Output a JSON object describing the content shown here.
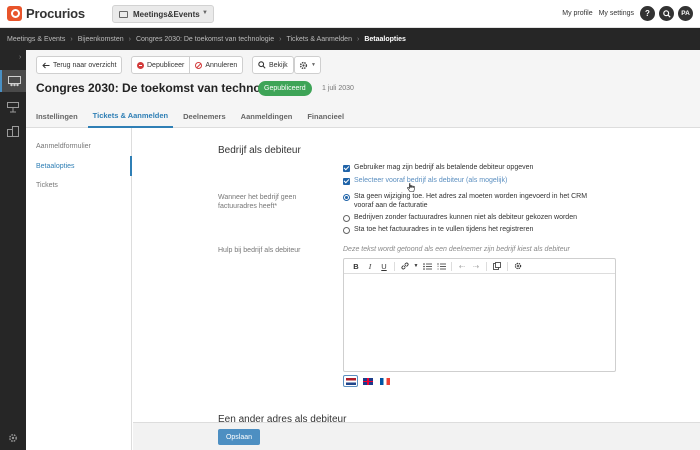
{
  "topbar": {
    "logo_text": "Procurios",
    "module": "Meetings&Events",
    "profile_link": "My profile",
    "settings_link": "My settings",
    "help_label": "?",
    "avatar_initials": "PA"
  },
  "breadcrumb": [
    "Meetings & Events",
    "Bijeenkomsten",
    "Congres 2030: De toekomst van technologie",
    "Tickets & Aanmelden",
    "Betaalopties"
  ],
  "toolbar": {
    "back_label": "Terug naar overzicht",
    "depublish_label": "Depubliceer",
    "cancel_label": "Annuleren",
    "view_label": "Bekijk"
  },
  "page": {
    "title": "Congres 2030: De toekomst van technologie",
    "status": "Gepubliceerd",
    "date": "1 juli 2030"
  },
  "tabs": [
    {
      "label": "Instellingen",
      "active": false
    },
    {
      "label": "Tickets & Aanmelden",
      "active": true
    },
    {
      "label": "Deelnemers",
      "active": false
    },
    {
      "label": "Aanmeldingen",
      "active": false
    },
    {
      "label": "Financieel",
      "active": false
    }
  ],
  "sidenav": [
    {
      "label": "Aanmeldformulier",
      "active": false
    },
    {
      "label": "Betaalopties",
      "active": true
    },
    {
      "label": "Tickets",
      "active": false
    }
  ],
  "main": {
    "section_title": "Bedrijf als debiteur",
    "checkbox_1": "Gebruiker mag zijn bedrijf als betalende debiteur opgeven",
    "checkbox_2": "Selecteer vooraf bedrijf als debiteur (als mogelijk)",
    "no_address_label_1": "Wanneer het bedrijf geen",
    "no_address_label_2": "factuuradres heeft*",
    "radio_1_line1": "Sta geen wijziging toe. Het adres zal moeten worden ingevoerd in het CRM",
    "radio_1_line2": "vooraf aan de facturatie",
    "radio_2": "Bedrijven zonder factuuradres kunnen niet als debiteur gekozen worden",
    "radio_3": "Sta toe het factuuradres in te vullen tijdens het registreren",
    "help_label": "Hulp bij bedrijf als debiteur",
    "help_hint": "Deze tekst wordt getoond als een deelnemer zijn bedrijf kiest als debiteur",
    "next_section_title": "Een ander adres als debiteur"
  },
  "editor_buttons": {
    "bold": "B",
    "italic": "I",
    "underline": "U"
  },
  "footer": {
    "save_label": "Opslaan"
  },
  "colors": {
    "accent": "#2f7fb5",
    "published": "#3ea457",
    "logo": "#e8542b",
    "dark_bar": "#262626"
  }
}
